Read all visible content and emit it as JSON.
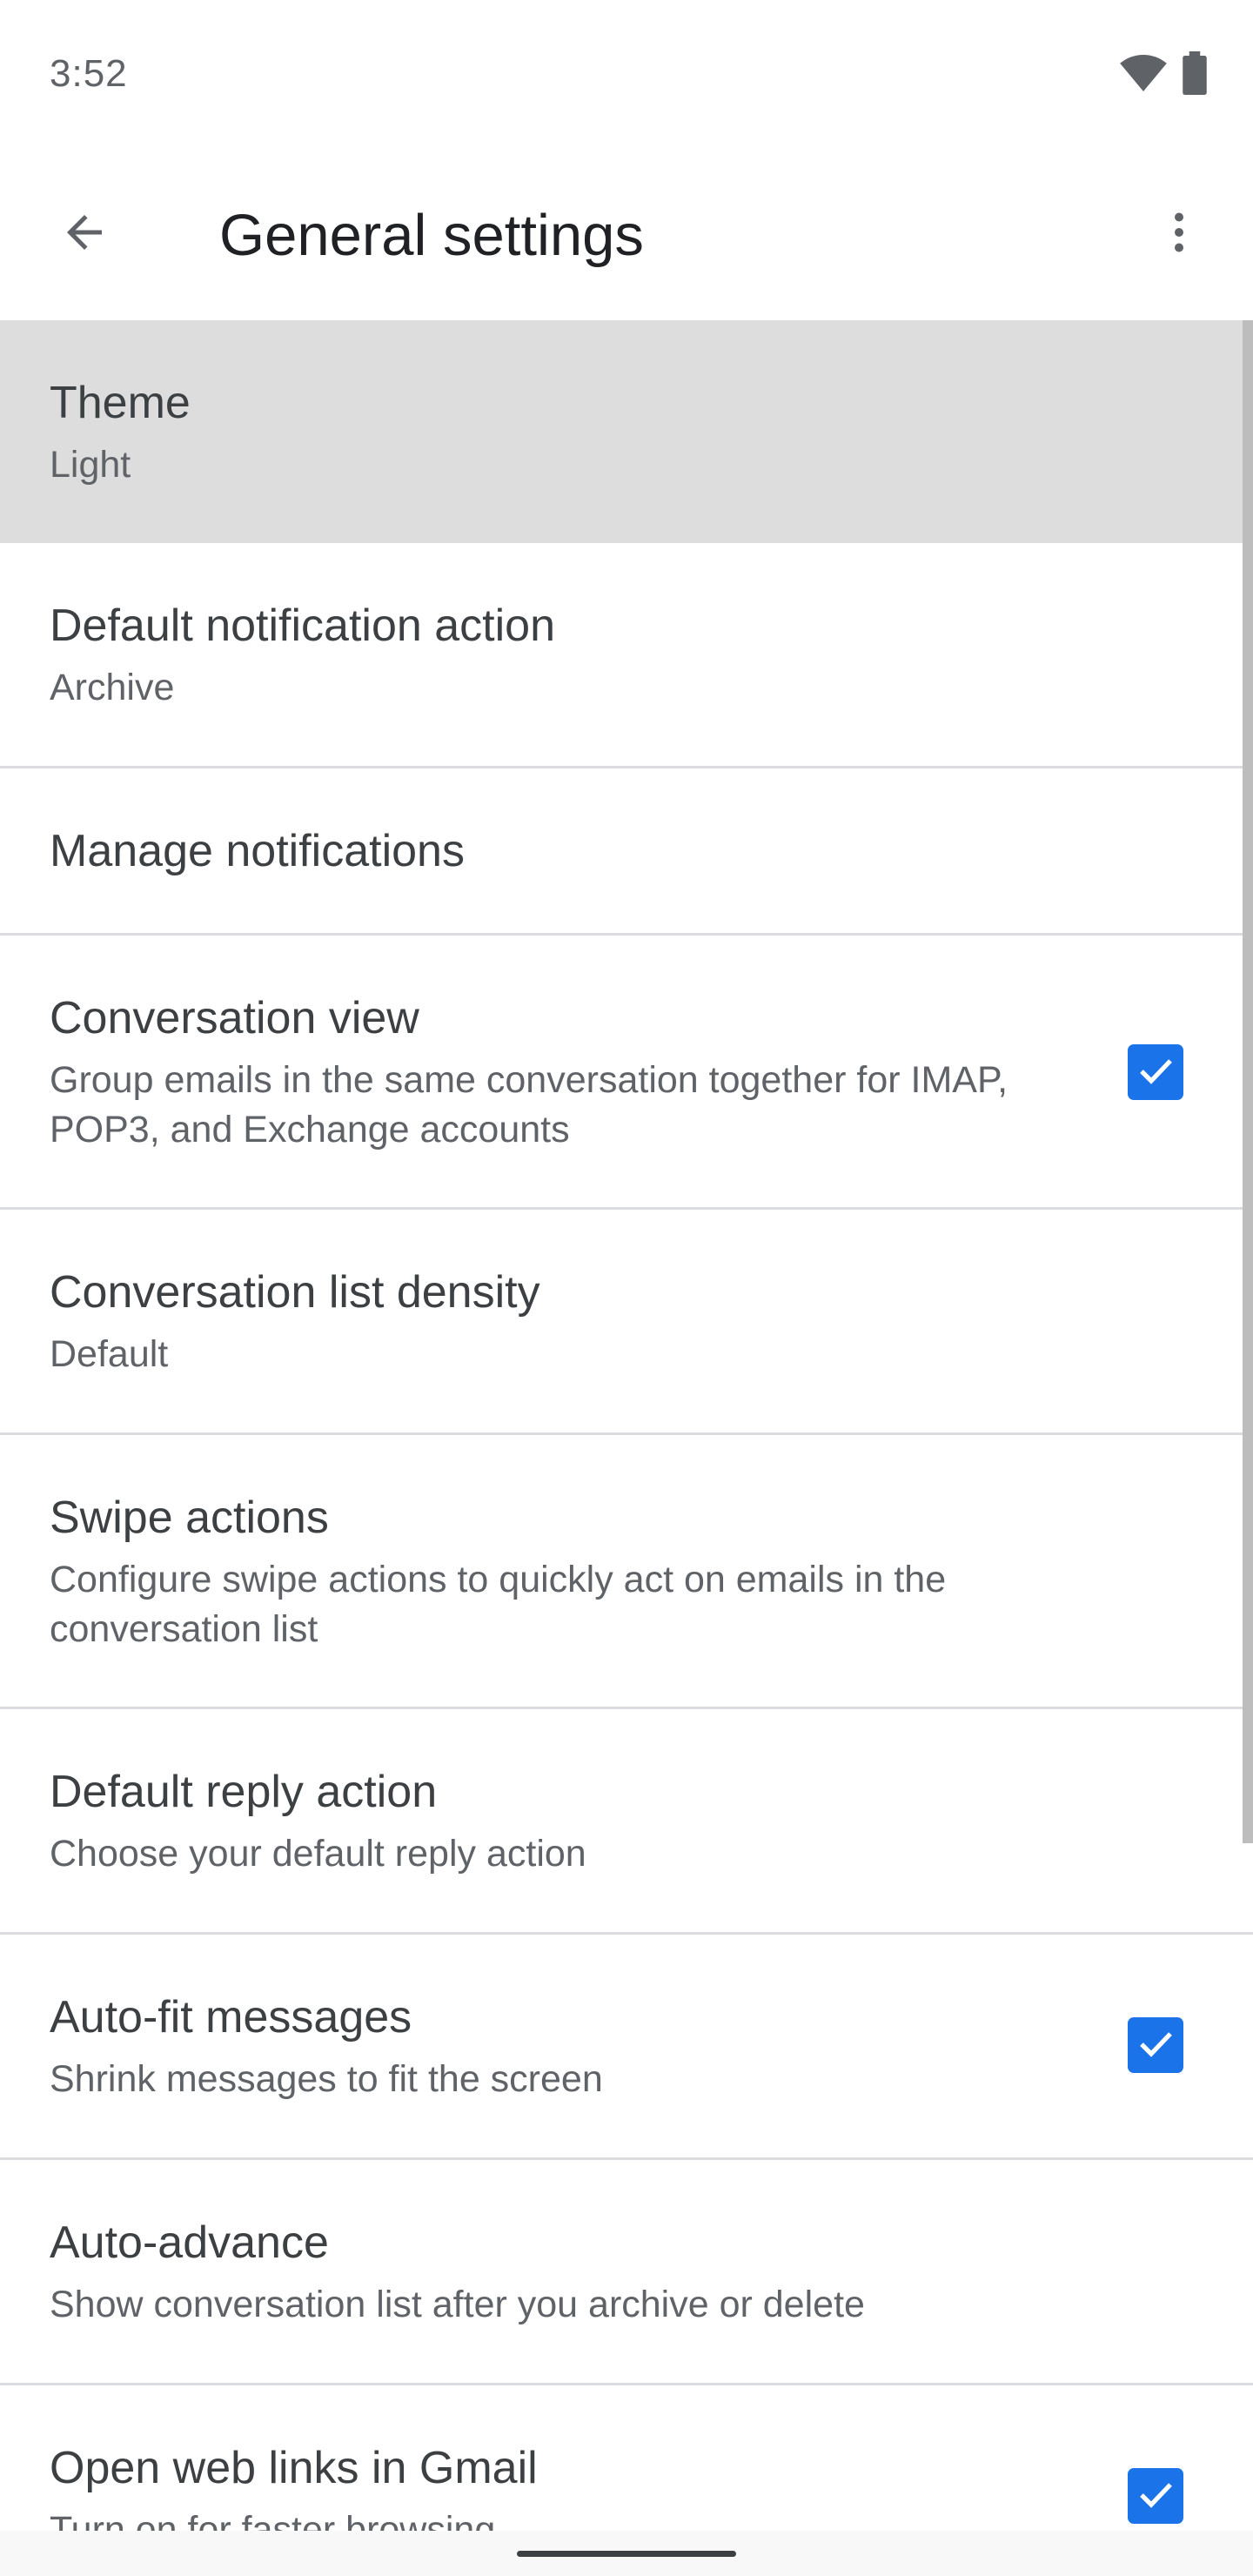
{
  "status_bar": {
    "time": "3:52",
    "icons": [
      "wifi-icon",
      "battery-icon"
    ]
  },
  "app_bar": {
    "title": "General settings",
    "back_icon": "arrow-back-icon",
    "overflow_icon": "more-vert-icon"
  },
  "colors": {
    "accent": "#1a73e8",
    "highlight_row": "#dddddd",
    "divider": "#dadce0"
  },
  "settings": [
    {
      "title": "Theme",
      "subtitle": "Light",
      "checked": null,
      "highlighted": true
    },
    {
      "title": "Default notification action",
      "subtitle": "Archive",
      "checked": null
    },
    {
      "title": "Manage notifications",
      "subtitle": "",
      "checked": null
    },
    {
      "title": "Conversation view",
      "subtitle": "Group emails in the same conversation together for IMAP, POP3, and Exchange accounts",
      "checked": true
    },
    {
      "title": "Conversation list density",
      "subtitle": "Default",
      "checked": null
    },
    {
      "title": "Swipe actions",
      "subtitle": "Configure swipe actions to quickly act on emails in the conversation list",
      "checked": null
    },
    {
      "title": "Default reply action",
      "subtitle": "Choose your default reply action",
      "checked": null
    },
    {
      "title": "Auto-fit messages",
      "subtitle": "Shrink messages to fit the screen",
      "checked": true
    },
    {
      "title": "Auto-advance",
      "subtitle": "Show conversation list after you archive or delete",
      "checked": null
    },
    {
      "title": "Open web links in Gmail",
      "subtitle": "Turn on for faster browsing",
      "checked": true
    }
  ]
}
